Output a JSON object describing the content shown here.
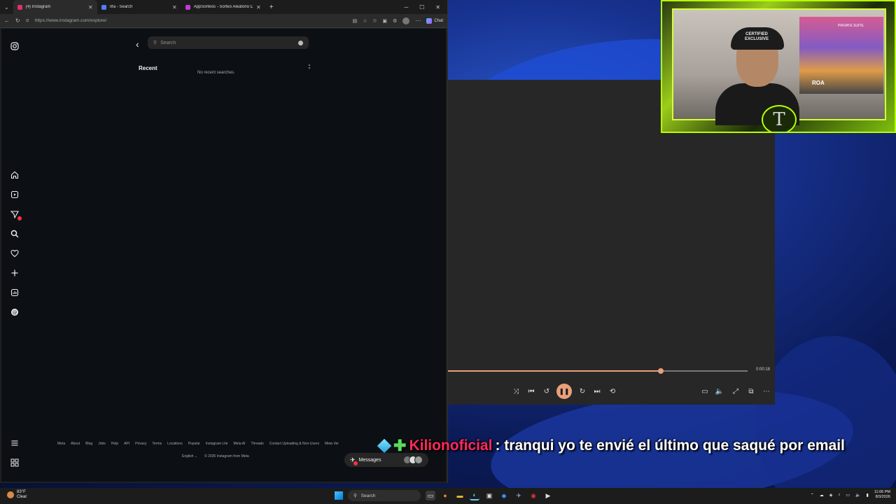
{
  "browser": {
    "tabs": [
      {
        "label": "(4) Instagram",
        "favicon_color": "#e1306c",
        "active": true
      },
      {
        "label": "rifa - Search",
        "favicon_color": "#4f7bff",
        "active": false
      },
      {
        "label": "AppSorteos - Sorteo Aleatorio De...",
        "favicon_color": "#c43ad8",
        "active": false
      }
    ],
    "new_tab_icon": "plus-icon",
    "url": "https://www.instagram.com/explore/",
    "chat_label": "Chat"
  },
  "instagram": {
    "search_placeholder": "Search",
    "recent_heading": "Recent",
    "no_recent_text": "No recent searches.",
    "footer_links": [
      "Meta",
      "About",
      "Blog",
      "Jobs",
      "Help",
      "API",
      "Privacy",
      "Terms",
      "Locations",
      "Popular",
      "Instagram Lite",
      "Meta AI",
      "Threads",
      "Contact Uploading & Non-Users",
      "Meta Ver"
    ],
    "language": "English",
    "copyright": "© 2026 Instagram from Meta",
    "messages_label": "Messages",
    "notification_count": "4"
  },
  "player": {
    "time": "0:00:18",
    "progress_fraction": 0.71,
    "accent": "#e8a07a"
  },
  "webcam": {
    "cap_text": "CERTIFIED EXCLUSIVE",
    "shelf_text": "PRIVATE SUITE",
    "sign_text": "ROA",
    "emblem_letter": "T",
    "frame_color": "#b6ff00"
  },
  "chat": {
    "username": "Kilionoficial",
    "message": ": tranqui yo te envié el último que saqué por email"
  },
  "taskbar": {
    "weather_temp": "83°F",
    "weather_desc": "Clear",
    "search_label": "Search",
    "time": "11:06 PM",
    "date": "8/3/2026"
  }
}
